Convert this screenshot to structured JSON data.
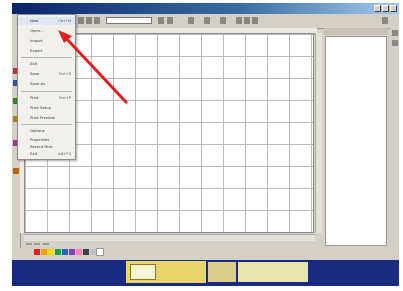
{
  "window": {
    "title": "",
    "title_text_color": "#ffffff",
    "titlebar_color": "#0a246a"
  },
  "toolbar": {
    "buttons": [
      "new-icon",
      "open-icon",
      "save-icon",
      "print-icon",
      "cut-icon",
      "copy-icon",
      "paste-icon",
      "undo-icon",
      "redo-icon",
      "zoom-icon",
      "grid-icon"
    ],
    "combo_value": ""
  },
  "menu": {
    "items": [
      {
        "label": "New",
        "shortcut": "Ctrl+N"
      },
      {
        "label": "Open...",
        "shortcut": ""
      },
      {
        "label": "Import",
        "shortcut": ""
      },
      {
        "label": "Export",
        "shortcut": ""
      },
      {
        "label": "Exit",
        "shortcut": ""
      },
      {
        "label": "Save",
        "shortcut": "Ctrl+S"
      },
      {
        "label": "Save As",
        "shortcut": ""
      },
      {
        "label": "Print",
        "shortcut": "Ctrl+P"
      },
      {
        "label": "Print Setup",
        "shortcut": ""
      },
      {
        "label": "Print Preview",
        "shortcut": ""
      },
      {
        "label": "Options",
        "shortcut": ""
      },
      {
        "label": "Properties",
        "shortcut": ""
      },
      {
        "label": "Recent Files",
        "shortcut": ""
      },
      {
        "label": "Exit",
        "shortcut": "Alt+F4"
      }
    ]
  },
  "side_panel": {
    "header": "",
    "content": ""
  },
  "tabs": [
    "",
    "",
    ""
  ],
  "palette": [
    "#e02020",
    "#f0a000",
    "#f0e000",
    "#20a040",
    "#2060d0",
    "#8040c0",
    "#ff80c0",
    "#404040",
    "#c0c0c0",
    "#ffffff",
    "#000000"
  ],
  "ads": {
    "left_heading": "",
    "left_subtext": "",
    "right_heading": "",
    "right_subtext": ""
  },
  "annotation": {
    "arrow_color": "#e02020"
  }
}
